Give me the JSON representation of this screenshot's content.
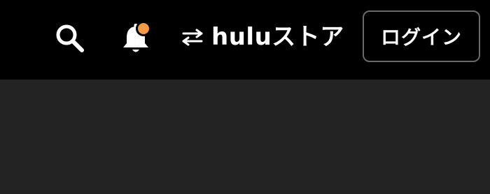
{
  "header": {
    "icons": {
      "search": "search-icon",
      "notifications": "bell-icon",
      "switch": "swap-arrows-icon"
    },
    "store_link_label": "huluストア",
    "login_label": "ログイン",
    "colors": {
      "header_bg": "#000000",
      "content_bg": "#232323",
      "badge": "#F2994A",
      "text": "#FFFFFF",
      "login_border": "#6A6A6A"
    }
  }
}
